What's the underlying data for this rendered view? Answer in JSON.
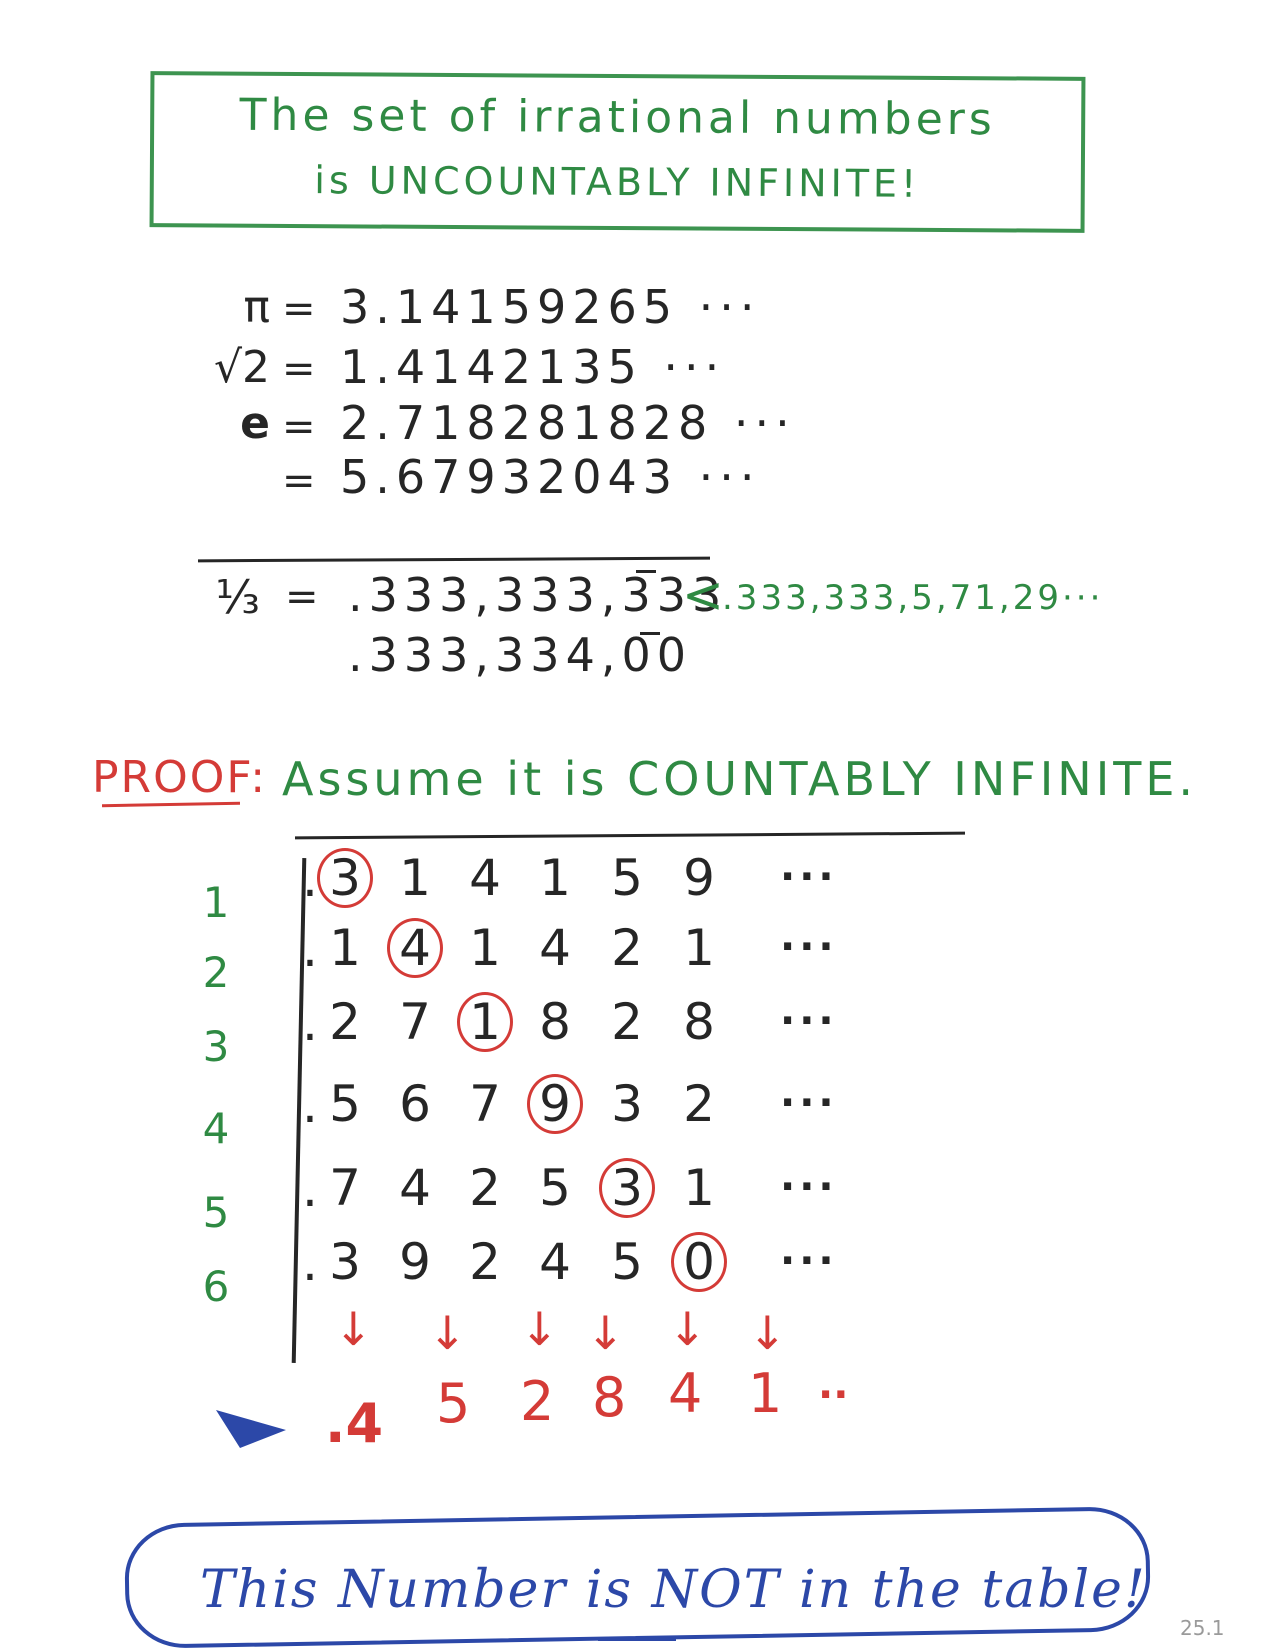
{
  "title": {
    "line1": "The set of irrational numbers",
    "line2": "is UNCOUNTABLY INFINITE!"
  },
  "equations": [
    {
      "label": "π",
      "sign": "=",
      "value": "3.14159265 ···"
    },
    {
      "label": "√2",
      "sign": "=",
      "value": "1.4142135 ···"
    },
    {
      "label": "e",
      "sign": "=",
      "value": "2.718281828 ···"
    },
    {
      "label": "",
      "sign": "=",
      "value": "5.67932043 ···"
    }
  ],
  "third": {
    "label": "⅓",
    "sign": "=",
    "value1": ".333,333,333",
    "value2": ".333,334,00",
    "comparison_mark": "<",
    "comparison_value": ".333,333,5,71,29···"
  },
  "proof": {
    "label": "PROOF:",
    "text": "Assume it is COUNTABLY INFINITE."
  },
  "table": {
    "rows": [
      {
        "num": "1",
        "digits": [
          "3",
          "1",
          "4",
          "1",
          "5",
          "9"
        ],
        "circled": 0
      },
      {
        "num": "2",
        "digits": [
          "1",
          "4",
          "1",
          "4",
          "2",
          "1"
        ],
        "circled": 1
      },
      {
        "num": "3",
        "digits": [
          "2",
          "7",
          "1",
          "8",
          "2",
          "8"
        ],
        "circled": 2
      },
      {
        "num": "4",
        "digits": [
          "5",
          "6",
          "7",
          "9",
          "3",
          "2"
        ],
        "circled": 3
      },
      {
        "num": "5",
        "digits": [
          "7",
          "4",
          "2",
          "5",
          "3",
          "1"
        ],
        "circled": 4
      },
      {
        "num": "6",
        "digits": [
          "3",
          "9",
          "2",
          "4",
          "5",
          "0"
        ],
        "circled": 5
      }
    ],
    "ellipsis": "···"
  },
  "arrow_symbol": "↓",
  "result": {
    "digits": [
      ".4",
      "5",
      "2",
      "8",
      "4",
      "1"
    ],
    "ellipsis": "··"
  },
  "callout": {
    "prefix": "This Number is ",
    "emphasis": "NOT",
    "suffix": " in the table!"
  },
  "page_number": "25.1",
  "colors": {
    "green": "#2f8a43",
    "red": "#d43b37",
    "black": "#262626",
    "blue": "#2c48a8"
  }
}
